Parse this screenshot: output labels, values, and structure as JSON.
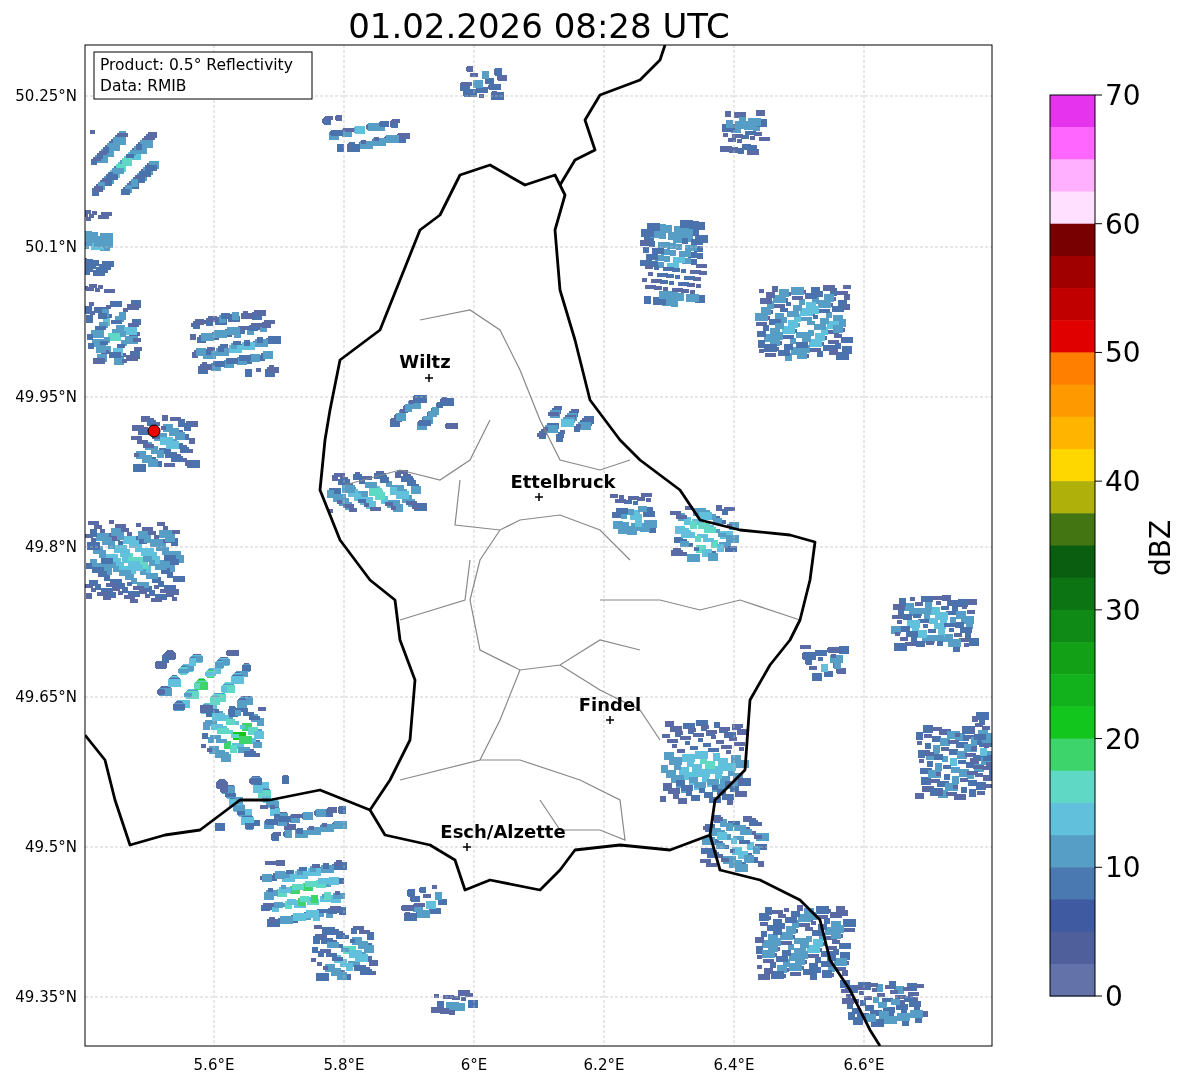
{
  "title": "01.02.2026 08:28 UTC",
  "legend": [
    "Product: 0.5° Reflectivity",
    "Data: RMIB"
  ],
  "latitude_labels": [
    "50.25°N",
    "50.1°N",
    "49.95°N",
    "49.8°N",
    "49.65°N",
    "49.5°N",
    "49.35°N"
  ],
  "longitude_labels": [
    "5.6°E",
    "5.8°E",
    "6°E",
    "6.2°E",
    "6.4°E",
    "6.6°E"
  ],
  "cities": [
    {
      "name": "Wiltz"
    },
    {
      "name": "Ettelbruck"
    },
    {
      "name": "Findel"
    },
    {
      "name": "Esch/Alzette"
    }
  ],
  "colorbar": {
    "label": "dBZ",
    "ticks": [
      "70",
      "60",
      "50",
      "40",
      "30",
      "20",
      "10",
      "0"
    ],
    "segments": [
      {
        "color": "#e633ee"
      },
      {
        "color": "#ff66ff"
      },
      {
        "color": "#ffb0ff"
      },
      {
        "color": "#ffe0ff"
      },
      {
        "color": "#780000"
      },
      {
        "color": "#a00000"
      },
      {
        "color": "#c00000"
      },
      {
        "color": "#e00000"
      },
      {
        "color": "#ff7f00"
      },
      {
        "color": "#ff9900"
      },
      {
        "color": "#ffb500"
      },
      {
        "color": "#ffd700"
      },
      {
        "color": "#b0b00a"
      },
      {
        "color": "#447513"
      },
      {
        "color": "#0a5e10"
      },
      {
        "color": "#0d7414"
      },
      {
        "color": "#0f8a16"
      },
      {
        "color": "#12a017"
      },
      {
        "color": "#12b21c"
      },
      {
        "color": "#12c61e"
      },
      {
        "color": "#3dd46c"
      },
      {
        "color": "#5fd8c6"
      },
      {
        "color": "#61c0dc"
      },
      {
        "color": "#579ec7"
      },
      {
        "color": "#4a78b0"
      },
      {
        "color": "#3f5aa0"
      },
      {
        "color": "#4f5f9c"
      },
      {
        "color": "#6372a8"
      }
    ]
  }
}
